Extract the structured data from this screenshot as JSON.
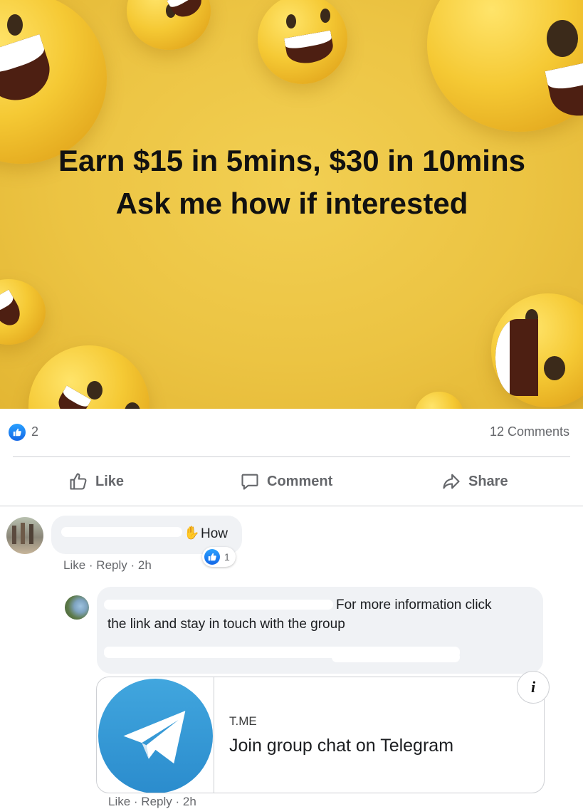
{
  "post": {
    "image_text": "Earn $15 in 5mins, $30 in 10mins Ask me how if interested",
    "reaction_count": "2",
    "comments_count": "12 Comments"
  },
  "actions": {
    "like": "Like",
    "comment": "Comment",
    "share": "Share"
  },
  "comments": [
    {
      "text": "How",
      "reaction_count": "1",
      "meta": {
        "like": "Like",
        "sep1": " · ",
        "reply": "Reply",
        "sep2": " · ",
        "time": "2h"
      }
    }
  ],
  "reply": {
    "text_line1": "For more information click",
    "text_line2": "the link and stay in touch with the group",
    "meta": {
      "like": "Like",
      "sep1": " · ",
      "reply": "Reply",
      "sep2": " · ",
      "time": "2h"
    },
    "link_card": {
      "domain": "T.ME",
      "title": "Join group chat on Telegram",
      "info_label": "i"
    }
  },
  "colors": {
    "hero_background": "#ecc443",
    "like_blue": "#1877f2",
    "meta_gray": "#65676b",
    "bubble_gray": "#f0f2f5",
    "telegram_blue": "#3a9dd8"
  },
  "icons": [
    "like-reaction-icon",
    "thumbs-up-icon",
    "comment-icon",
    "share-icon",
    "waving-hand-icon",
    "telegram-logo-icon",
    "info-icon"
  ]
}
